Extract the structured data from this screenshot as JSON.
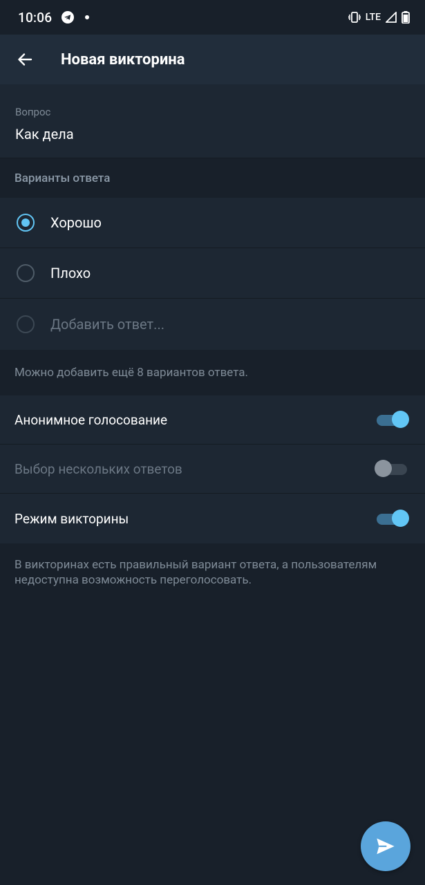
{
  "status_bar": {
    "time": "10:06",
    "network": "LTE",
    "icons": [
      "telegram-icon",
      "notification-dot",
      "vibrate-icon",
      "signal-icon",
      "battery-icon"
    ]
  },
  "app_bar": {
    "title": "Новая викторина",
    "back_icon": "arrow-back-icon"
  },
  "question": {
    "label": "Вопрос",
    "value": "Как дела"
  },
  "answers_section": {
    "header": "Варианты ответа",
    "items": [
      {
        "text": "Хорошо",
        "selected": true
      },
      {
        "text": "Плохо",
        "selected": false
      }
    ],
    "add_placeholder": "Добавить ответ...",
    "hint": "Можно добавить ещё 8 вариантов ответа."
  },
  "settings": {
    "items": [
      {
        "label": "Анонимное голосование",
        "enabled": true,
        "on": true
      },
      {
        "label": "Выбор нескольких ответов",
        "enabled": false,
        "on": false
      },
      {
        "label": "Режим викторины",
        "enabled": true,
        "on": true
      }
    ],
    "hint": "В викторинах есть правильный вариант ответа, а пользователям недоступна возможность переголосовать."
  },
  "fab": {
    "icon": "send-icon"
  },
  "colors": {
    "background": "#18202a",
    "surface": "#1d2733",
    "app_bar": "#212d3b",
    "accent": "#62c6f5",
    "fab": "#5aa5dc"
  }
}
